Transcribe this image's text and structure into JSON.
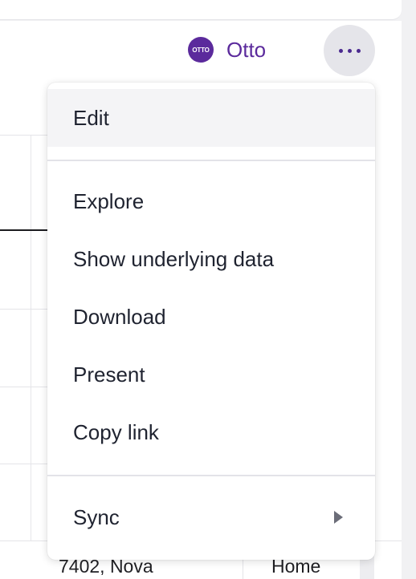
{
  "header": {
    "otto_logo_text": "OTTO",
    "otto_label": "Otto",
    "more_icon": "ellipsis-icon"
  },
  "menu": {
    "items": [
      {
        "label": "Edit"
      },
      {
        "label": "Explore"
      },
      {
        "label": "Show underlying data"
      },
      {
        "label": "Download"
      },
      {
        "label": "Present"
      },
      {
        "label": "Copy link"
      },
      {
        "label": "Sync",
        "submenu_icon": "chevron-right-icon"
      }
    ]
  },
  "table": {
    "visible_row": {
      "address": "7402, Nova",
      "type": "Home"
    }
  },
  "colors": {
    "accent": "#5b2a9c",
    "menu_hover": "#f4f4f6",
    "text": "#1f2330"
  }
}
